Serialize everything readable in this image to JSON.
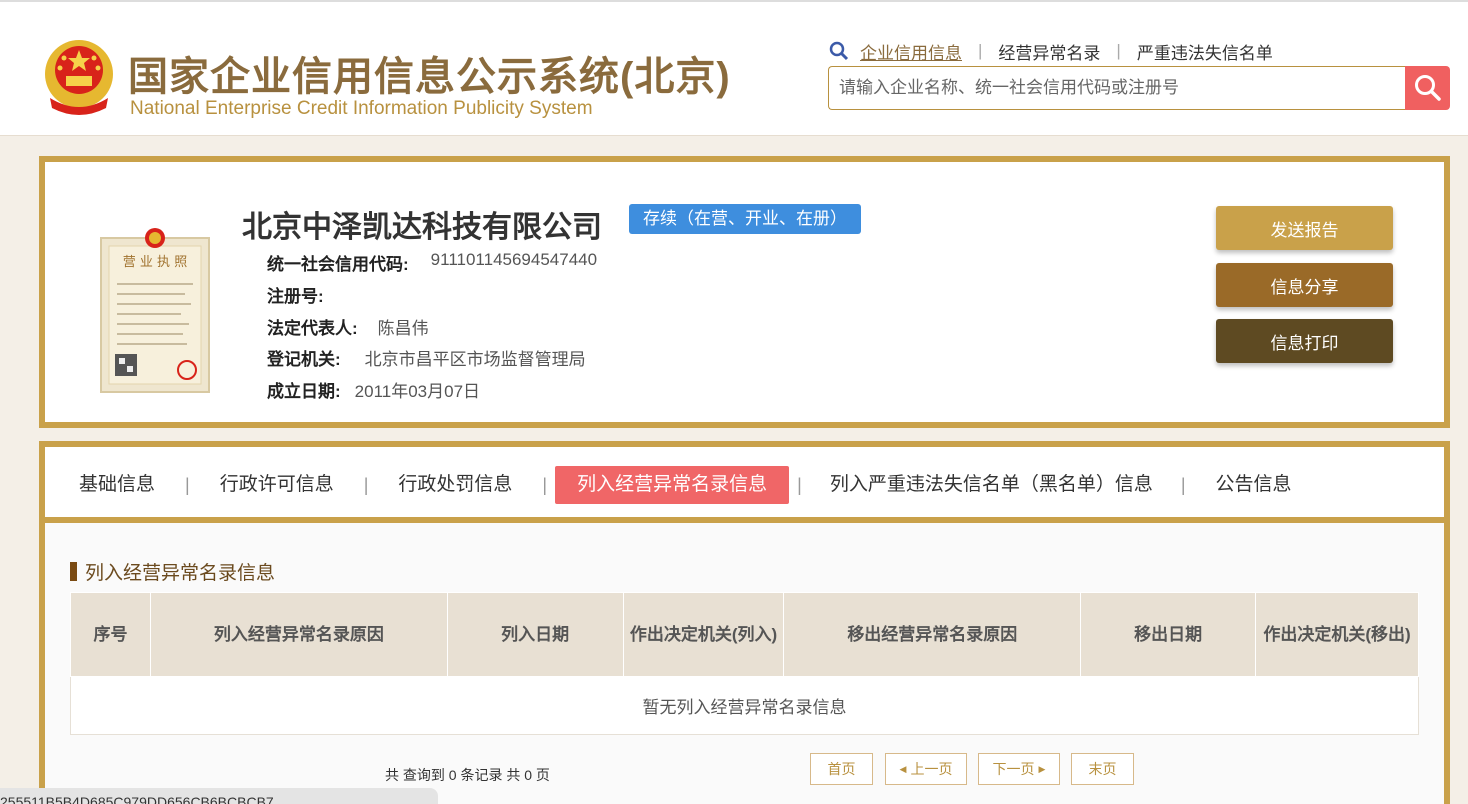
{
  "header": {
    "title_cn": "国家企业信用信息公示系统(北京)",
    "title_en": "National Enterprise Credit Information Publicity System",
    "links": [
      "企业信用信息",
      "经营异常名录",
      "严重违法失信名单"
    ],
    "search_placeholder": "请输入企业名称、统一社会信用代码或注册号",
    "colors": {
      "brand": "#8a6b3d",
      "search_button": "#f06060"
    }
  },
  "company": {
    "name": "北京中泽凯达科技有限公司",
    "status": "存续（在营、开业、在册）",
    "fields": [
      {
        "label": "统一社会信用代码:",
        "value": "911101145694547440"
      },
      {
        "label": "注册号:",
        "value": ""
      },
      {
        "label": "法定代表人:",
        "value": "陈昌伟"
      },
      {
        "label": "登记机关:",
        "value": "北京市昌平区市场监督管理局"
      },
      {
        "label": "成立日期:",
        "value": "2011年03月07日"
      }
    ],
    "license_image_text": "营业执照",
    "actions": [
      "发送报告",
      "信息分享",
      "信息打印"
    ]
  },
  "tabs": [
    "基础信息",
    "行政许可信息",
    "行政处罚信息",
    "列入经营异常名录信息",
    "列入严重违法失信名单（黑名单）信息",
    "公告信息"
  ],
  "active_tab": "列入经营异常名录信息",
  "section": {
    "title": "列入经营异常名录信息",
    "columns": [
      "序号",
      "列入经营异常名录原因",
      "列入日期",
      "作出决定机关(列入)",
      "移出经营异常名录原因",
      "移出日期",
      "作出决定机关(移出)"
    ],
    "empty_message": "暂无列入经营异常名录信息"
  },
  "pager": {
    "summary": "共 查询到 0 条记录 共 0 页",
    "first": "首页",
    "prev": "上一页",
    "next": "下一页",
    "last": "末页"
  },
  "bottom_chip": "255511B5B4D685C979DD656CB6BCBCB7"
}
